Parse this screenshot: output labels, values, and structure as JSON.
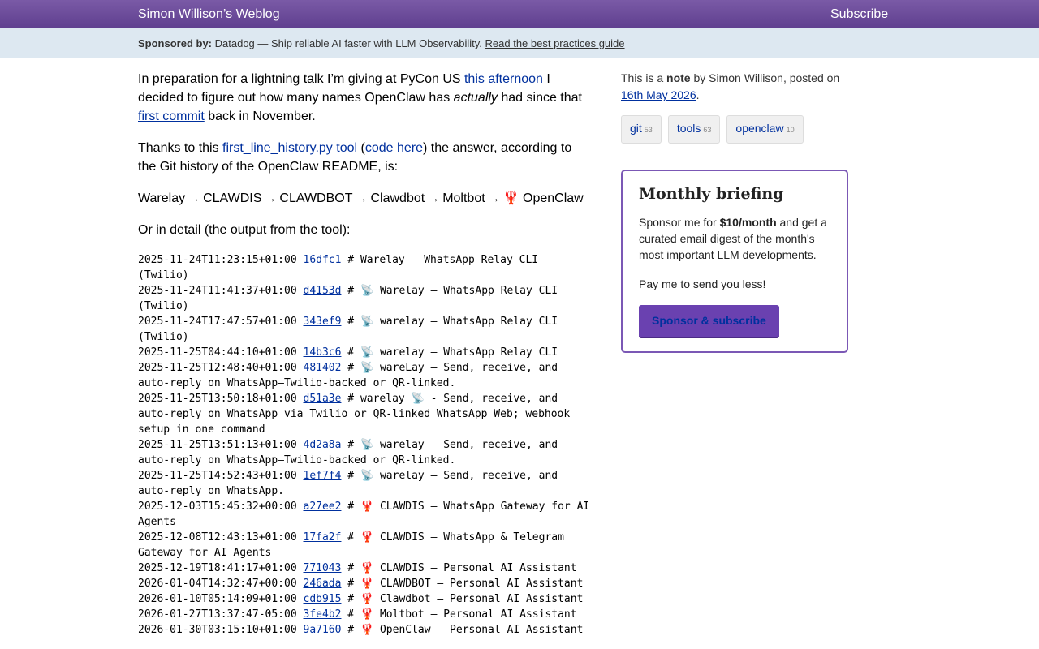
{
  "header": {
    "site_title": "Simon Willison’s Weblog",
    "subscribe_label": "Subscribe"
  },
  "sponsor": {
    "prefix": "Sponsored by:",
    "text": "Datadog — Ship reliable AI faster with LLM Observability.",
    "link": "Read the best practices guide"
  },
  "article": {
    "p1_a": "In preparation for a lightning talk I’m giving at PyCon US ",
    "p1_link": "this afternoon",
    "p1_b": " I decided to figure out how many names OpenClaw has ",
    "p1_em": "actually",
    "p1_c": " had since that ",
    "p1_link2": "first commit",
    "p1_d": " back in November.",
    "p2_a": "Thanks to this ",
    "p2_link": "first_line_history.py tool",
    "p2_b": " (",
    "p2_link2": "code here",
    "p2_c": ") the answer, according to the Git history of the OpenClaw README, is:",
    "chain": [
      "Warelay",
      "CLAWDIS",
      "CLAWDBOT",
      "Clawdbot",
      "Moltbot",
      "🦞 OpenClaw"
    ],
    "arrow": "→",
    "p3": "Or in detail (the output from the tool):",
    "commits": [
      {
        "date": "2025-11-24T11:23:15+01:00",
        "hash": "16dfc1",
        "msg": "# Warelay — WhatsApp Relay CLI (Twilio)"
      },
      {
        "date": "2025-11-24T11:41:37+01:00",
        "hash": "d4153d",
        "msg": "# 📡 Warelay — WhatsApp Relay CLI (Twilio)"
      },
      {
        "date": "2025-11-24T17:47:57+01:00",
        "hash": "343ef9",
        "msg": "# 📡 warelay — WhatsApp Relay CLI (Twilio)"
      },
      {
        "date": "2025-11-25T04:44:10+01:00",
        "hash": "14b3c6",
        "msg": "# 📡 warelay — WhatsApp Relay CLI"
      },
      {
        "date": "2025-11-25T12:48:40+01:00",
        "hash": "481402",
        "msg": "# 📡 wareLay — Send, receive, and auto-reply on WhatsApp—Twilio-backed or QR-linked."
      },
      {
        "date": "2025-11-25T13:50:18+01:00",
        "hash": "d51a3e",
        "msg": "# warelay 📡 - Send, receive, and auto-reply on WhatsApp via Twilio or QR-linked WhatsApp Web; webhook setup in one command"
      },
      {
        "date": "2025-11-25T13:51:13+01:00",
        "hash": "4d2a8a",
        "msg": "# 📡 warelay — Send, receive, and auto-reply on WhatsApp—Twilio-backed or QR-linked."
      },
      {
        "date": "2025-11-25T14:52:43+01:00",
        "hash": "1ef7f4",
        "msg": "# 📡 warelay — Send, receive, and auto-reply on WhatsApp."
      },
      {
        "date": "2025-12-03T15:45:32+00:00",
        "hash": "a27ee2",
        "msg": "# 🦞 CLAWDIS — WhatsApp Gateway for AI Agents"
      },
      {
        "date": "2025-12-08T12:43:13+01:00",
        "hash": "17fa2f",
        "msg": "# 🦞 CLAWDIS — WhatsApp & Telegram Gateway for AI Agents"
      },
      {
        "date": "2025-12-19T18:41:17+01:00",
        "hash": "771043",
        "msg": "# 🦞 CLAWDIS — Personal AI Assistant"
      },
      {
        "date": "2026-01-04T14:32:47+00:00",
        "hash": "246ada",
        "msg": "# 🦞 CLAWDBOT — Personal AI Assistant"
      },
      {
        "date": "2026-01-10T05:14:09+01:00",
        "hash": "cdb915",
        "msg": "# 🦞 Clawdbot — Personal AI Assistant"
      },
      {
        "date": "2026-01-27T13:37:47-05:00",
        "hash": "3fe4b2",
        "msg": "# 🦞 Moltbot — Personal AI Assistant"
      },
      {
        "date": "2026-01-30T03:15:10+01:00",
        "hash": "9a7160",
        "msg": "# 🦞 OpenClaw — Personal AI Assistant"
      }
    ]
  },
  "sidebar": {
    "meta_a": "This is a ",
    "meta_bold": "note",
    "meta_b": " by Simon Willison, posted on ",
    "date_link": "16th May 2026",
    "meta_end": ".",
    "tags": [
      {
        "label": "git",
        "count": "53"
      },
      {
        "label": "tools",
        "count": "63"
      },
      {
        "label": "openclaw",
        "count": "10"
      }
    ],
    "briefing": {
      "title": "Monthly briefing",
      "text_a": "Sponsor me for ",
      "text_bold": "$10/month",
      "text_b": " and get a curated email digest of the month's most important LLM developments.",
      "text2": "Pay me to send you less!",
      "button": "Sponsor & subscribe"
    }
  }
}
